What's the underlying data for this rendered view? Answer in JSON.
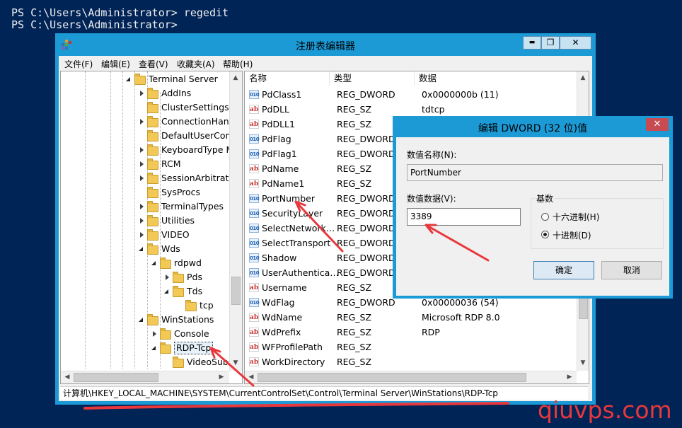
{
  "console": {
    "line1": "PS C:\\Users\\Administrator> regedit",
    "line2": "PS C:\\Users\\Administrator>"
  },
  "window": {
    "title": "注册表编辑器",
    "min": "▬",
    "max": "❐",
    "close": "✕"
  },
  "menu": [
    "文件(F)",
    "编辑(E)",
    "查看(V)",
    "收藏夹(A)",
    "帮助(H)"
  ],
  "tree": [
    {
      "label": "Terminal Server",
      "expander": "open"
    },
    {
      "label": "AddIns",
      "expander": "closed"
    },
    {
      "label": "ClusterSettings",
      "expander": ""
    },
    {
      "label": "ConnectionHandler",
      "expander": "closed"
    },
    {
      "label": "DefaultUserConfiguration",
      "expander": ""
    },
    {
      "label": "KeyboardType Mapping",
      "expander": "closed"
    },
    {
      "label": "RCM",
      "expander": "closed"
    },
    {
      "label": "SessionArbitrationHelper",
      "expander": "closed"
    },
    {
      "label": "SysProcs",
      "expander": ""
    },
    {
      "label": "TerminalTypes",
      "expander": "closed"
    },
    {
      "label": "Utilities",
      "expander": "closed"
    },
    {
      "label": "VIDEO",
      "expander": "closed"
    },
    {
      "label": "Wds",
      "expander": "open"
    },
    {
      "label": "rdpwd",
      "expander": "open"
    },
    {
      "label": "Pds",
      "expander": "closed"
    },
    {
      "label": "Tds",
      "expander": "open"
    },
    {
      "label": "tcp",
      "expander": ""
    },
    {
      "label": "WinStations",
      "expander": "open"
    },
    {
      "label": "Console",
      "expander": "closed"
    },
    {
      "label": "RDP-Tcp",
      "expander": "open"
    },
    {
      "label": "VideoSubsystem",
      "expander": ""
    }
  ],
  "list": {
    "headers": [
      "名称",
      "类型",
      "数据"
    ],
    "rows": [
      {
        "icon": "dword",
        "name": "PdClass1",
        "type": "REG_DWORD",
        "data": "0x0000000b (11)"
      },
      {
        "icon": "sz",
        "name": "PdDLL",
        "type": "REG_SZ",
        "data": "tdtcp"
      },
      {
        "icon": "sz",
        "name": "PdDLL1",
        "type": "REG_SZ",
        "data": ""
      },
      {
        "icon": "dword",
        "name": "PdFlag",
        "type": "REG_DWORD",
        "data": ""
      },
      {
        "icon": "dword",
        "name": "PdFlag1",
        "type": "REG_DWORD",
        "data": ""
      },
      {
        "icon": "sz",
        "name": "PdName",
        "type": "REG_SZ",
        "data": ""
      },
      {
        "icon": "sz",
        "name": "PdName1",
        "type": "REG_SZ",
        "data": ""
      },
      {
        "icon": "dword",
        "name": "PortNumber",
        "type": "REG_DWORD",
        "data": ""
      },
      {
        "icon": "dword",
        "name": "SecurityLayer",
        "type": "REG_DWORD",
        "data": ""
      },
      {
        "icon": "dword",
        "name": "SelectNetwork…",
        "type": "REG_DWORD",
        "data": ""
      },
      {
        "icon": "dword",
        "name": "SelectTransport",
        "type": "REG_DWORD",
        "data": ""
      },
      {
        "icon": "dword",
        "name": "Shadow",
        "type": "REG_DWORD",
        "data": ""
      },
      {
        "icon": "dword",
        "name": "UserAuthentica…",
        "type": "REG_DWORD",
        "data": ""
      },
      {
        "icon": "sz",
        "name": "Username",
        "type": "REG_SZ",
        "data": ""
      },
      {
        "icon": "dword",
        "name": "WdFlag",
        "type": "REG_DWORD",
        "data": "0x00000036 (54)"
      },
      {
        "icon": "sz",
        "name": "WdName",
        "type": "REG_SZ",
        "data": "Microsoft RDP 8.0"
      },
      {
        "icon": "sz",
        "name": "WdPrefix",
        "type": "REG_SZ",
        "data": "RDP"
      },
      {
        "icon": "sz",
        "name": "WFProfilePath",
        "type": "REG_SZ",
        "data": ""
      },
      {
        "icon": "sz",
        "name": "WorkDirectory",
        "type": "REG_SZ",
        "data": ""
      }
    ]
  },
  "icon_text": {
    "sz": "ab",
    "dword": "010"
  },
  "status_path": "计算机\\HKEY_LOCAL_MACHINE\\SYSTEM\\CurrentControlSet\\Control\\Terminal Server\\WinStations\\RDP-Tcp",
  "dialog": {
    "title": "编辑 DWORD (32 位)值",
    "name_label": "数值名称(N):",
    "name_value": "PortNumber",
    "data_label": "数值数据(V):",
    "data_value": "3389",
    "base_label": "基数",
    "hex_label": "十六进制(H)",
    "dec_label": "十进制(D)",
    "selected_base": "dec",
    "ok": "确定",
    "cancel": "取消",
    "close": "✕"
  },
  "watermark": "qiuvps.com",
  "colors": {
    "console_bg": "#012456",
    "title_bar": "#1b9ad6",
    "annotation": "#e8383d",
    "close_btn": "#c74b50"
  }
}
